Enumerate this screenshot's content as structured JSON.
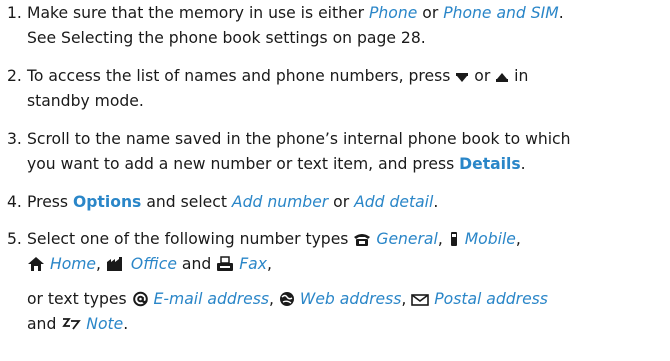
{
  "colors": {
    "text": "#1a1a1a",
    "option": "#2a86c8",
    "key": "#2a86c8",
    "icon": "#1a1a1a"
  },
  "steps": [
    {
      "number": "1.",
      "l1_a": "Make sure that the memory in use is either",
      "l1_opt1": "Phone",
      "l1_b": "or",
      "l1_opt2": "Phone and SIM",
      "l1_c": ".",
      "l2": "See Selecting the phone book settings on page 28."
    },
    {
      "number": "2.",
      "l1_a": "To access the list of names and phone numbers, press",
      "l1_b": "or",
      "l1_c": "in",
      "l2": "standby mode.",
      "icons": [
        "scroll-down-icon",
        "scroll-up-icon"
      ]
    },
    {
      "number": "3.",
      "l1": "Scroll to the name saved in the phone’s internal phone book to which",
      "l2_a": "you want to add a new number or text item, and press",
      "l2_key": "Details",
      "l2_b": "."
    },
    {
      "number": "4.",
      "a": "Press",
      "key": "Options",
      "b": "and select",
      "opt1": "Add number",
      "c": "or",
      "opt2": "Add detail",
      "d": "."
    },
    {
      "number": "5.",
      "intro": "Select one of the following number types",
      "general": "General",
      "mobile": "Mobile",
      "home": "Home",
      "office": "Office",
      "and1": "and",
      "fax": "Fax",
      "text_intro": "or text types",
      "email": "E-mail address",
      "web": "Web address",
      "postal": "Postal address",
      "and2": "and",
      "note": "Note",
      "icons": [
        "general-phone-icon",
        "mobile-icon",
        "home-icon",
        "office-icon",
        "fax-icon",
        "email-at-icon",
        "web-globe-icon",
        "postal-envelope-icon",
        "note-icon"
      ]
    }
  ]
}
